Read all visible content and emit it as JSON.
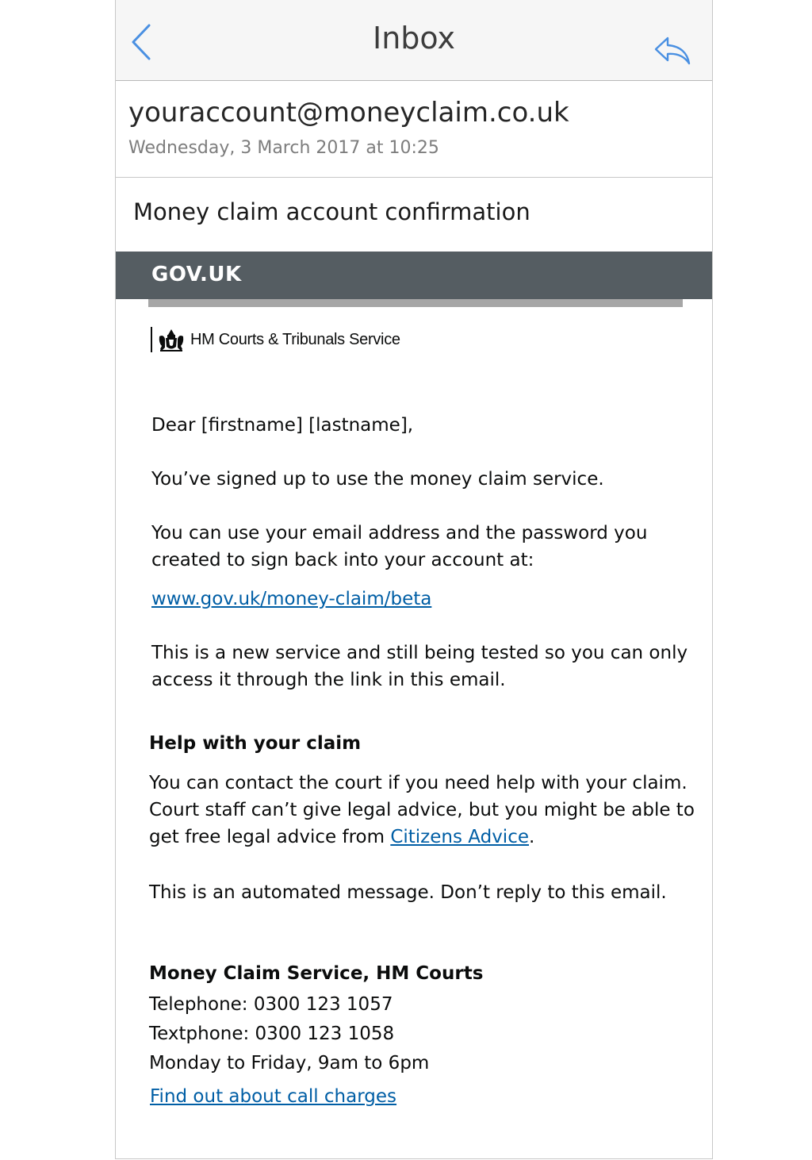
{
  "navbar": {
    "title": "Inbox",
    "back_icon": "chevron-left-icon",
    "reply_icon": "reply-arrow-icon"
  },
  "email": {
    "from": "youraccount@moneyclaim.co.uk",
    "date": "Wednesday, 3 March 2017 at 10:25",
    "subject": "Money claim account confirmation"
  },
  "banner": {
    "logo": "GOV.UK",
    "department": "HM Courts & Tribunals Service",
    "crest_icon": "royal-crest-icon"
  },
  "body": {
    "greeting": "Dear [firstname] [lastname],",
    "signed_up": "You’ve signed up to use the money claim service.",
    "sign_in_line1": "You can use your email address and the password you",
    "sign_in_line2": "created to sign back into your account at:",
    "service_link": "www.gov.uk/money-claim/beta",
    "beta_line1": "This is a new service and still being tested so you can only",
    "beta_line2": "access it through the link in this email.",
    "help_heading": "Help with your claim",
    "help_line1": "You can contact the court if you need help with your claim.",
    "help_line2": "Court staff can’t give legal advice, but you might be able to",
    "help_line3_prefix": "get free legal advice from ",
    "citizens_advice_link": "Citizens Advice",
    "help_line3_suffix": ".",
    "automated": "This is an automated message. Don’t reply to this email."
  },
  "contact": {
    "heading": "Money Claim Service, HM Courts",
    "telephone": "Telephone: 0300 123 1057",
    "textphone": "Textphone: 0300 123 1058",
    "hours": "Monday to Friday, 9am to 6pm",
    "charges_link": "Find out about call charges"
  },
  "colors": {
    "link": "#005ea5",
    "govuk_bar": "#555d62",
    "ios_blue": "#4a90e2"
  }
}
